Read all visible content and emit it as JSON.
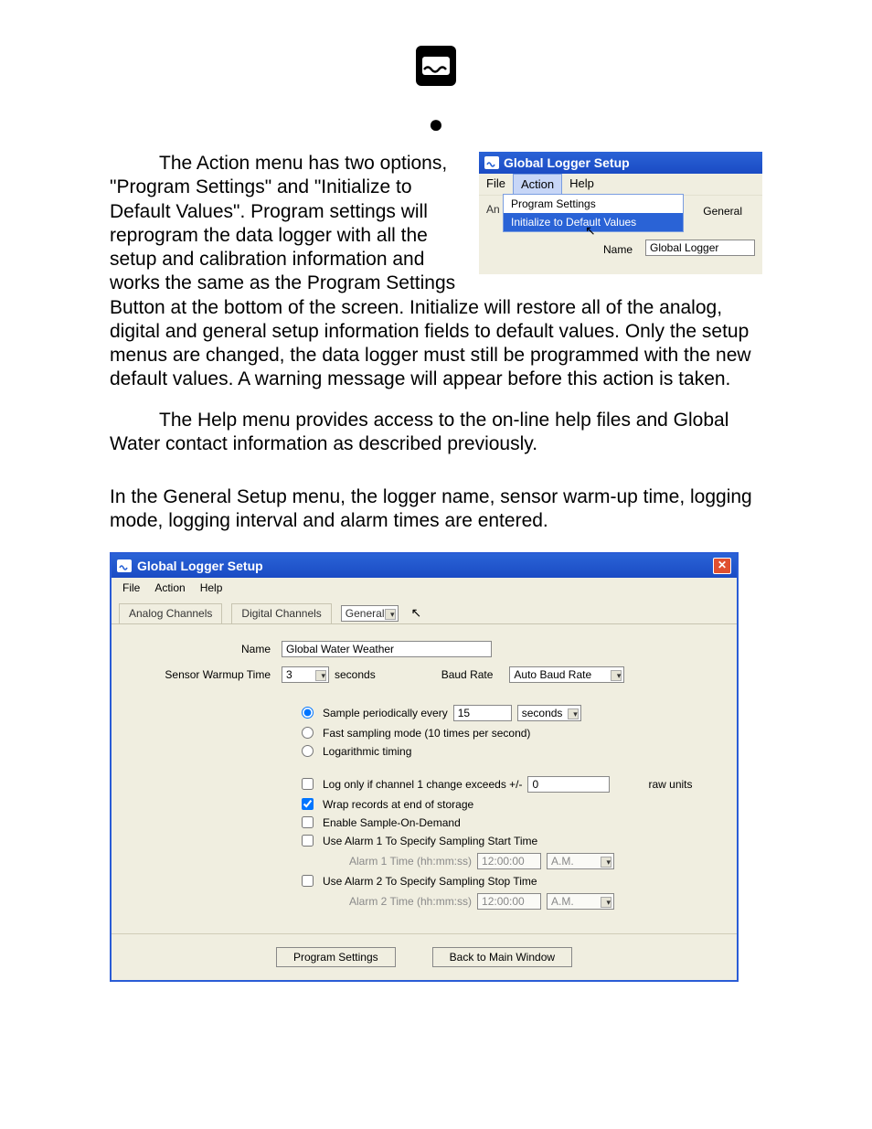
{
  "logo_alt": "wave-icon",
  "bullet": "●",
  "para1_lead": "The Action menu has two options, \"Program Settings\" and \"Initialize to Default Values\".  Program settings will reprogram the data logger with all the setup and calibration information and works the same as the Program Settings Button at the bottom of the screen.  Initialize will restore all of the analog, digital and general setup information fields to default values.  Only the setup menus are changed, the data logger must still be programmed with the new default values.  A warning message will appear before this action is taken.",
  "para2": "The Help menu provides access to the on-line help files and Global Water contact information as described previously.",
  "para3": "In the General Setup menu, the logger name, sensor warm-up time, logging mode, logging interval and alarm times are entered.",
  "mini": {
    "title": "Global Logger Setup",
    "menus": [
      "File",
      "Action",
      "Help"
    ],
    "dropdown": [
      "Program Settings",
      "Initialize to Default Values"
    ],
    "tab_left": "An",
    "tab_right": "General",
    "name_label": "Name",
    "name_value": "Global Logger"
  },
  "win": {
    "title": "Global Logger Setup",
    "menus": [
      "File",
      "Action",
      "Help"
    ],
    "tabs": [
      "Analog Channels",
      "Digital Channels",
      "General"
    ],
    "name_label": "Name",
    "name_value": "Global Water Weather",
    "warmup_label": "Sensor Warmup Time",
    "warmup_value": "3",
    "warmup_unit": "seconds",
    "baud_label": "Baud Rate",
    "baud_value": "Auto Baud Rate",
    "radio1": "Sample periodically every",
    "radio1_value": "15",
    "radio1_unit": "seconds",
    "radio2": "Fast sampling mode (10 times per second)",
    "radio3": "Logarithmic timing",
    "chk1": "Log only if channel 1 change exceeds +/-",
    "chk1_value": "0",
    "chk1_unit": "raw units",
    "chk2": "Wrap records at end of storage",
    "chk3": "Enable Sample-On-Demand",
    "chk4": "Use Alarm 1 To Specify Sampling Start Time",
    "alarm1_label": "Alarm 1 Time (hh:mm:ss)",
    "alarm1_value": "12:00:00",
    "alarm1_ampm": "A.M.",
    "chk5": "Use Alarm 2 To Specify Sampling Stop Time",
    "alarm2_label": "Alarm 2 Time (hh:mm:ss)",
    "alarm2_value": "12:00:00",
    "alarm2_ampm": "A.M.",
    "btn1": "Program Settings",
    "btn2": "Back to Main Window"
  }
}
